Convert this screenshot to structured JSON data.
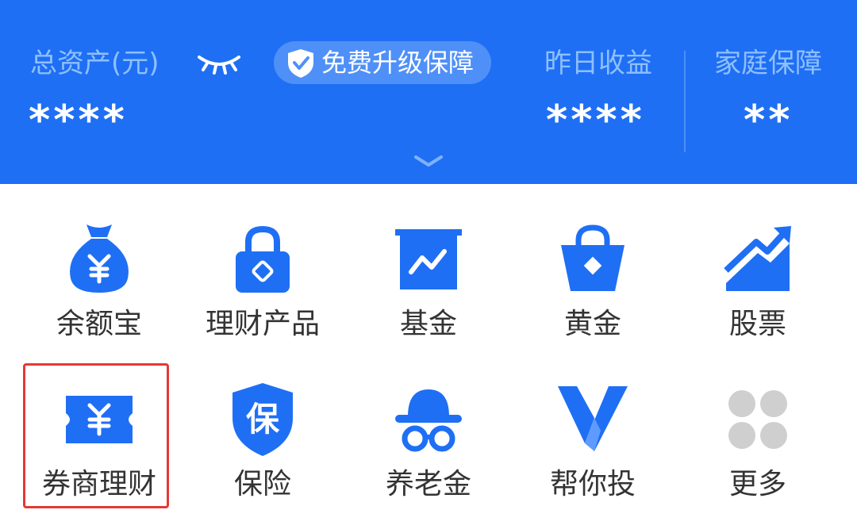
{
  "header": {
    "total_assets_label": "总资产(元)",
    "total_assets_value": "****",
    "upgrade_label": "免费升级保障",
    "yesterday_label": "昨日收益",
    "yesterday_value": "****",
    "family_label": "家庭保障",
    "family_value": "**"
  },
  "menu": [
    {
      "label": "余额宝",
      "icon": "money-bag-icon"
    },
    {
      "label": "理财产品",
      "icon": "lock-icon"
    },
    {
      "label": "基金",
      "icon": "fund-chart-icon"
    },
    {
      "label": "黄金",
      "icon": "gold-basket-icon"
    },
    {
      "label": "股票",
      "icon": "stock-trend-icon"
    },
    {
      "label": "券商理财",
      "icon": "coupon-icon"
    },
    {
      "label": "保险",
      "icon": "insurance-shield-icon"
    },
    {
      "label": "养老金",
      "icon": "pension-hat-glasses-icon"
    },
    {
      "label": "帮你投",
      "icon": "v-logo-icon"
    },
    {
      "label": "更多",
      "icon": "more-grid-icon"
    }
  ],
  "colors": {
    "primary": "#1f6ff5",
    "highlight": "#e53935"
  }
}
